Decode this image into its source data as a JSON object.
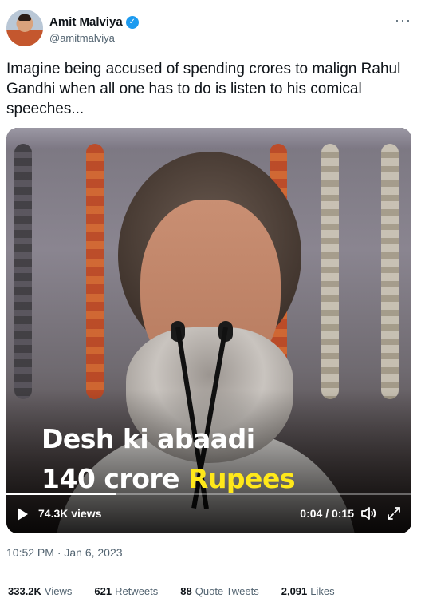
{
  "author": {
    "name": "Amit Malviya",
    "handle": "@amitmalviya",
    "verified_icon": "verified-badge-icon",
    "more_icon": "more-options-icon"
  },
  "tweet": {
    "text": "Imagine being accused of spending crores to malign Rahul Gandhi when all one has to do is listen to his comical speeches..."
  },
  "video": {
    "caption_line1": "Desh ki abaadi",
    "caption_line2_white": "140 crore ",
    "caption_line2_highlight": "Rupees",
    "highlight_color": "#ffe81a",
    "views": "74.3K views",
    "time": "0:04 / 0:15",
    "progress": 0.27,
    "play_icon": "play-icon",
    "volume_icon": "volume-icon",
    "expand_icon": "fullscreen-icon"
  },
  "timestamp": "10:52 PM · Jan 6, 2023",
  "stats": [
    {
      "value": "333.2K",
      "label": "Views"
    },
    {
      "value": "621",
      "label": "Retweets"
    },
    {
      "value": "88",
      "label": "Quote Tweets"
    },
    {
      "value": "2,091",
      "label": "Likes"
    }
  ],
  "colors": {
    "accent": "#1d9bf0",
    "secondary_text": "#536471"
  }
}
